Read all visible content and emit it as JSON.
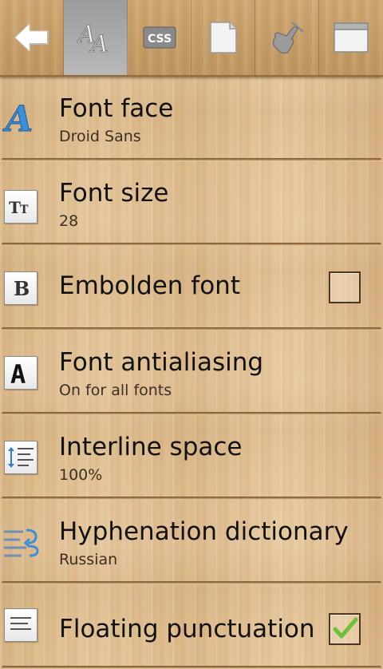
{
  "toolbar": {
    "items": [
      {
        "name": "back",
        "icon": "back-arrow-icon",
        "selected": false
      },
      {
        "name": "font-settings",
        "icon": "font-aa-icon",
        "selected": true
      },
      {
        "name": "css",
        "icon": "css-icon",
        "label": "CSS",
        "selected": false
      },
      {
        "name": "page",
        "icon": "page-icon",
        "selected": false
      },
      {
        "name": "controls",
        "icon": "tap-hand-icon",
        "selected": false
      },
      {
        "name": "window",
        "icon": "window-icon",
        "selected": false
      }
    ]
  },
  "settings": [
    {
      "title": "Font face",
      "summary": "Droid Sans",
      "icon": "font-face-icon"
    },
    {
      "title": "Font size",
      "summary": "28",
      "icon": "font-size-icon"
    },
    {
      "title": "Embolden font",
      "summary": "",
      "icon": "bold-icon",
      "checkbox": true,
      "checked": false
    },
    {
      "title": "Font antialiasing",
      "summary": "On for all fonts",
      "icon": "antialiasing-icon"
    },
    {
      "title": "Interline space",
      "summary": "100%",
      "icon": "interline-space-icon"
    },
    {
      "title": "Hyphenation dictionary",
      "summary": "Russian",
      "icon": "hyphenation-icon"
    },
    {
      "title": "Floating punctuation",
      "summary": "",
      "icon": "punctuation-icon",
      "checkbox": true,
      "checked": true
    }
  ],
  "colors": {
    "wood_base": "#dbb98a",
    "toolbar_selected": "#a9a9a9",
    "accent_blue": "#3b8fd8",
    "check_green": "#6cbf3a"
  }
}
